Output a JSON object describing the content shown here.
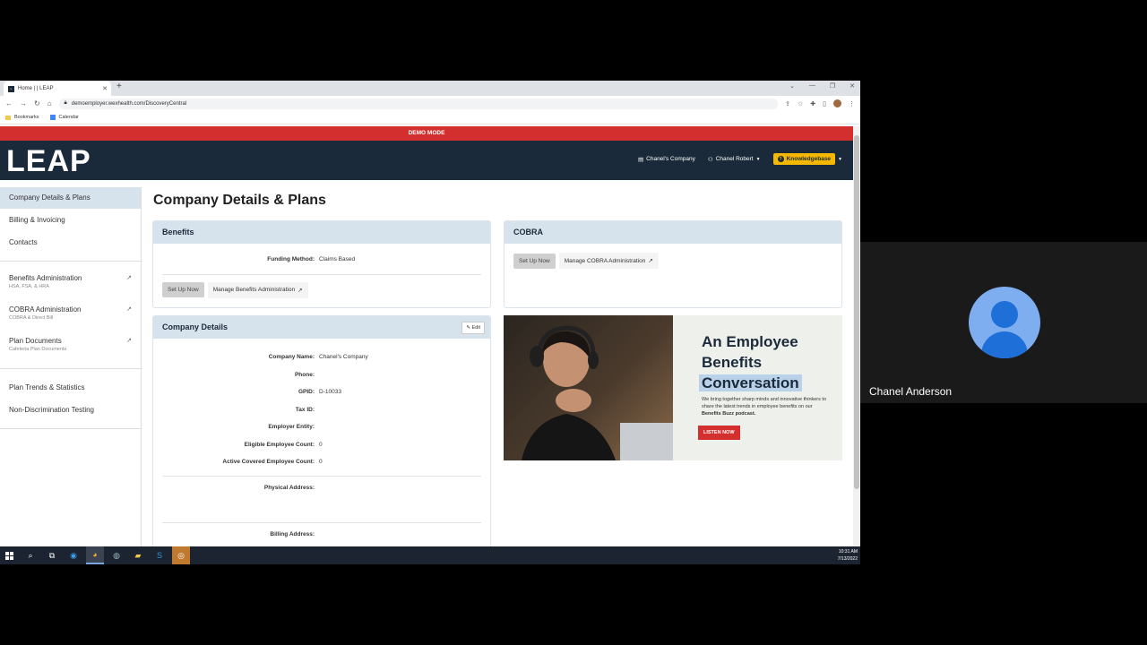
{
  "browser": {
    "tab_title": "Home | | LEAP",
    "url": "demoemployer.wexhealth.com/DiscoveryCentral",
    "bookmarks": [
      "Bookmarks",
      "Calendar"
    ]
  },
  "banner": {
    "text": "DEMO MODE"
  },
  "header": {
    "logo": "LEAP",
    "company": "Chanel's Company",
    "user": "Chanel Robert",
    "knowledgebase": "Knowledgebase"
  },
  "sidebar": {
    "items": [
      {
        "label": "Company Details & Plans",
        "sub": ""
      },
      {
        "label": "Billing & Invoicing",
        "sub": ""
      },
      {
        "label": "Contacts",
        "sub": ""
      },
      {
        "label": "Benefits Administration",
        "sub": "HSA, FSA, & HRA"
      },
      {
        "label": "COBRA Administration",
        "sub": "COBRA & Direct Bill"
      },
      {
        "label": "Plan Documents",
        "sub": "Cafeteria Plan Documents"
      },
      {
        "label": "Plan Trends & Statistics",
        "sub": ""
      },
      {
        "label": "Non-Discrimination Testing",
        "sub": ""
      }
    ]
  },
  "main": {
    "title": "Company Details & Plans",
    "benefits": {
      "title": "Benefits",
      "funding_label": "Funding Method:",
      "funding_value": "Claims Based",
      "setup_btn": "Set Up Now",
      "manage_btn": "Manage Benefits Administration"
    },
    "cobra": {
      "title": "COBRA",
      "setup_btn": "Set Up Now",
      "manage_btn": "Manage COBRA Administration"
    },
    "details": {
      "title": "Company Details",
      "edit_btn": "Edit",
      "fields": [
        {
          "label": "Company Name:",
          "value": "Chanel's Company"
        },
        {
          "label": "Phone:",
          "value": ""
        },
        {
          "label": "GPID:",
          "value": "D-10033"
        },
        {
          "label": "Tax ID:",
          "value": ""
        },
        {
          "label": "Employer Entity:",
          "value": ""
        },
        {
          "label": "Eligible Employee Count:",
          "value": "0"
        },
        {
          "label": "Active Covered Employee Count:",
          "value": "0"
        }
      ],
      "physical_address_label": "Physical Address:",
      "billing_address_label": "Billing Address:"
    },
    "promo": {
      "line1": "An Employee",
      "line2": "Benefits",
      "line3": "Conversation",
      "body_pre": "We bring together sharp minds and innovative thinkers to share the latest trends in employee benefits on our ",
      "body_bold": "Benefits Buzz podcast.",
      "cta": "LISTEN NOW"
    }
  },
  "taskbar": {
    "time": "10:31 AM",
    "date": "7/13/2022"
  },
  "participant": {
    "name": "Chanel Anderson"
  },
  "colors": {
    "brand_navy": "#1b2a3a",
    "demo_red": "#d32f2f",
    "kb_yellow": "#f5b800",
    "card_header": "#d6e2ec"
  }
}
